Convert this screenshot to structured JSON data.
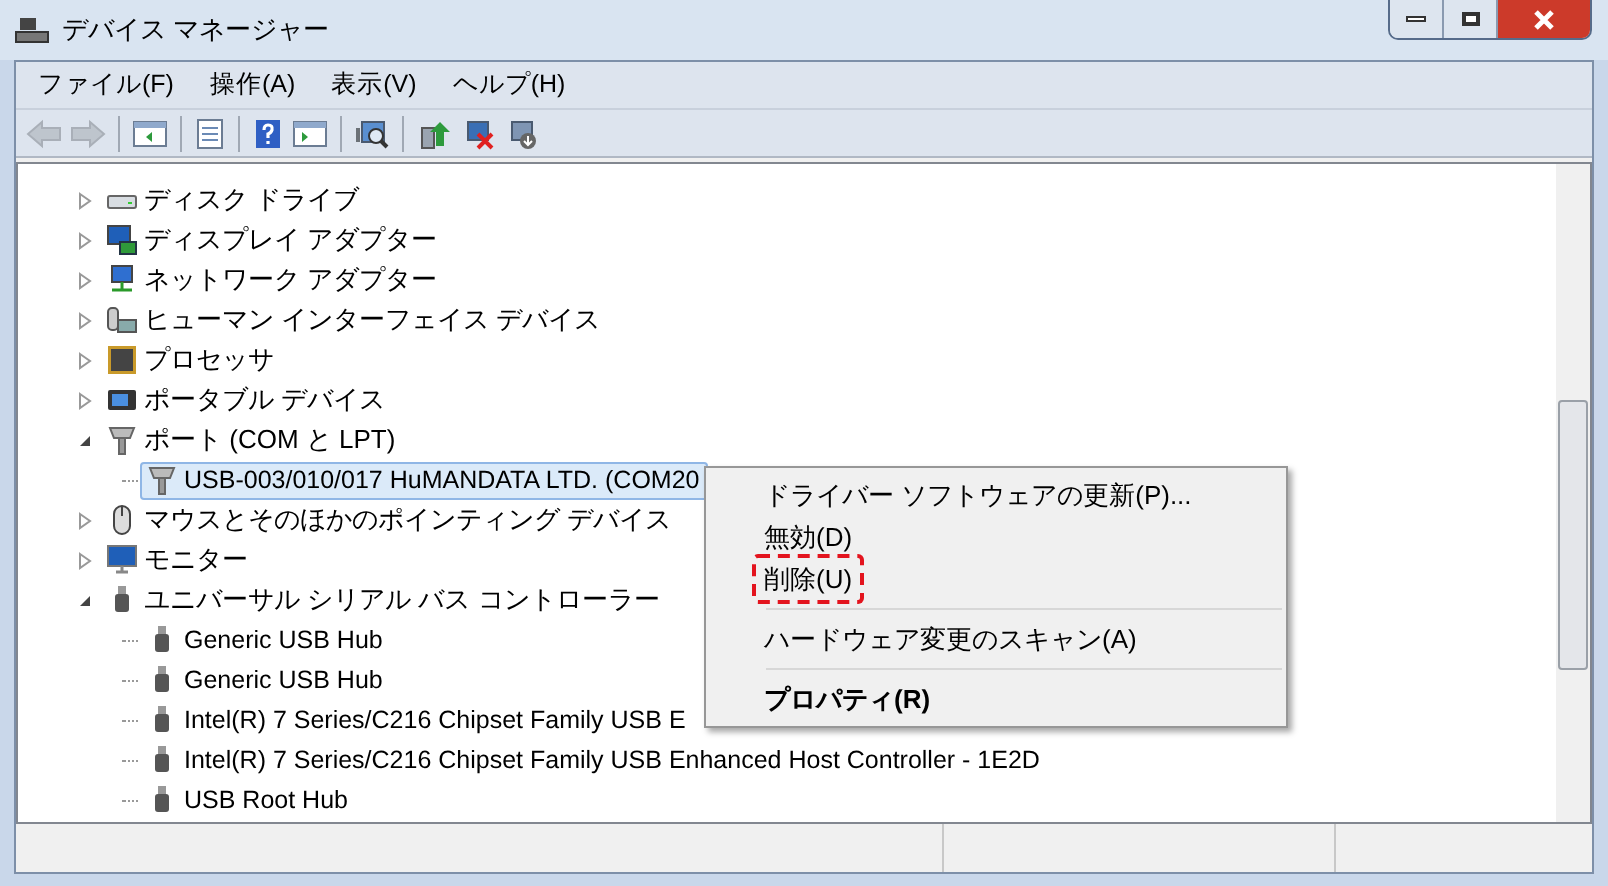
{
  "window": {
    "title": "デバイス マネージャー"
  },
  "menu": [
    "ファイル(F)",
    "操作(A)",
    "表示(V)",
    "ヘルプ(H)"
  ],
  "toolbar": [
    {
      "kind": "back",
      "disabled": true
    },
    {
      "kind": "forward",
      "disabled": true
    },
    {
      "kind": "sep"
    },
    {
      "kind": "tree"
    },
    {
      "kind": "sep"
    },
    {
      "kind": "properties"
    },
    {
      "kind": "sep"
    },
    {
      "kind": "help"
    },
    {
      "kind": "pane"
    },
    {
      "kind": "sep"
    },
    {
      "kind": "scan"
    },
    {
      "kind": "sep"
    },
    {
      "kind": "update"
    },
    {
      "kind": "uninstall"
    },
    {
      "kind": "disable"
    }
  ],
  "tree": [
    {
      "kind": "disk",
      "label": "ディスク ドライブ",
      "expanded": false
    },
    {
      "kind": "display",
      "label": "ディスプレイ アダプター",
      "expanded": false
    },
    {
      "kind": "network",
      "label": "ネットワーク アダプター",
      "expanded": false
    },
    {
      "kind": "hid",
      "label": "ヒューマン インターフェイス デバイス",
      "expanded": false
    },
    {
      "kind": "processor",
      "label": "プロセッサ",
      "expanded": false
    },
    {
      "kind": "portable",
      "label": "ポータブル デバイス",
      "expanded": false
    },
    {
      "kind": "port",
      "label": "ポート (COM と LPT)",
      "expanded": true,
      "children": [
        {
          "kind": "port",
          "label": "USB-003/010/017 HuMANDATA LTD. (COM20",
          "selected": true
        }
      ]
    },
    {
      "kind": "mouse",
      "label": "マウスとそのほかのポインティング デバイス",
      "expanded": false
    },
    {
      "kind": "monitor",
      "label": "モニター",
      "expanded": false
    },
    {
      "kind": "usb",
      "label": "ユニバーサル シリアル バス コントローラー",
      "expanded": true,
      "children": [
        {
          "kind": "usb",
          "label": "Generic USB Hub",
          "selected": false
        },
        {
          "kind": "usb",
          "label": "Generic USB Hub",
          "selected": false
        },
        {
          "kind": "usb",
          "label": "Intel(R) 7 Series/C216 Chipset Family USB E",
          "selected": false
        },
        {
          "kind": "usb",
          "label": "Intel(R) 7 Series/C216 Chipset Family USB Enhanced Host Controller - 1E2D",
          "selected": false
        },
        {
          "kind": "usb",
          "label": "USB Root Hub",
          "selected": false
        }
      ]
    }
  ],
  "context_menu": [
    {
      "label": "ドライバー ソフトウェアの更新(P)...",
      "bold": false,
      "marked": false
    },
    {
      "label": "無効(D)",
      "bold": false,
      "marked": false
    },
    {
      "label": "削除(U)",
      "bold": false,
      "marked": true
    },
    {
      "kind": "sep"
    },
    {
      "label": "ハードウェア変更のスキャン(A)",
      "bold": false,
      "marked": false
    },
    {
      "kind": "sep"
    },
    {
      "label": "プロパティ(R)",
      "bold": true,
      "marked": false
    }
  ]
}
